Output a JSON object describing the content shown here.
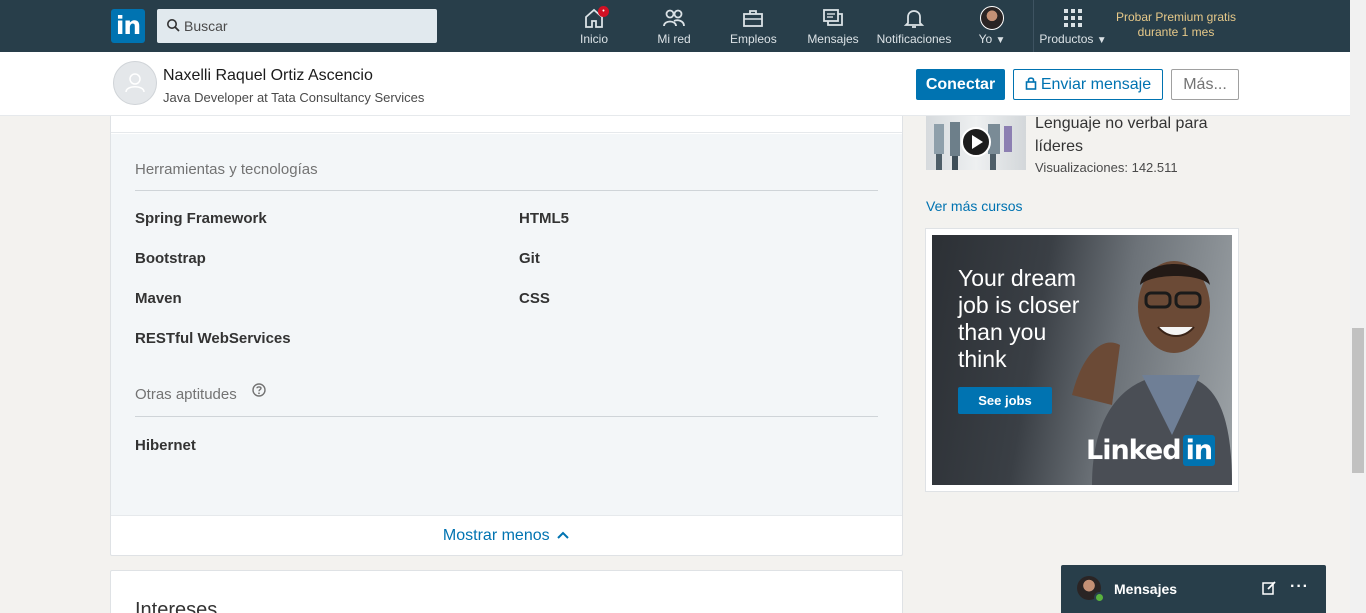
{
  "nav": {
    "logo_text": "in",
    "search_placeholder": "Buscar",
    "items": [
      {
        "label": "Inicio",
        "icon": "home-icon",
        "badge": "•"
      },
      {
        "label": "Mi red",
        "icon": "people-icon"
      },
      {
        "label": "Empleos",
        "icon": "briefcase-icon"
      },
      {
        "label": "Mensajes",
        "icon": "chat-icon"
      },
      {
        "label": "Notificaciones",
        "icon": "bell-icon"
      },
      {
        "label": "Yo",
        "icon": "avatar-icon"
      },
      {
        "label": "Productos",
        "icon": "grid-icon"
      }
    ],
    "premium_line1": "Probar Premium gratis",
    "premium_line2": "durante 1 mes"
  },
  "profile": {
    "name": "Naxelli Raquel Ortiz Ascencio",
    "headline": "Java Developer at Tata Consultancy Services",
    "connect_label": "Conectar",
    "message_label": "Enviar mensaje",
    "more_label": "Más..."
  },
  "skills": {
    "tools_title": "Herramientas y tecnologías",
    "tools": [
      "Spring Framework",
      "HTML5",
      "Bootstrap",
      "Git",
      "Maven",
      "CSS",
      "RESTful WebServices"
    ],
    "other_title": "Otras aptitudes",
    "other": [
      "Hibernet"
    ],
    "show_less": "Mostrar menos"
  },
  "next_section_title": "Intereses",
  "right_rail": {
    "course_title": "Lenguaje no verbal para líderes",
    "course_views": "Visualizaciones: 142.511",
    "more_courses": "Ver más cursos",
    "ad_headline": "Your dream job is closer than you think",
    "ad_cta": "See jobs",
    "ad_brand": "Linked",
    "ad_brand_in": "in"
  },
  "messaging": {
    "label": "Mensajes",
    "more": "···"
  },
  "colors": {
    "nav_bg": "#283e4a",
    "brand_blue": "#0073b1",
    "premium_gold": "#e7c989",
    "skills_bg": "#f3f6f8"
  }
}
